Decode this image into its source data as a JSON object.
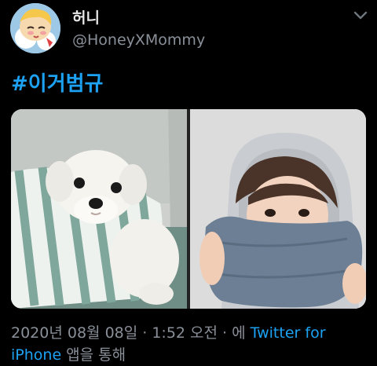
{
  "tweet": {
    "display_name": "허니",
    "handle": "@HoneyXMommy",
    "hashtag": "#이거범규",
    "timestamp": {
      "date_time": "2020년 08월 08일 · 1:52 오전 · 에 ",
      "source": "Twitter for iPhone",
      "suffix": " 앱을 통해"
    }
  },
  "colors": {
    "background": "#000000",
    "link": "#1da1f2",
    "secondary_text": "#8a9099"
  },
  "icons": {
    "menu": "chevron-down-icon"
  },
  "media": [
    {
      "description_name": "dog-photo"
    },
    {
      "description_name": "person-photo"
    }
  ]
}
